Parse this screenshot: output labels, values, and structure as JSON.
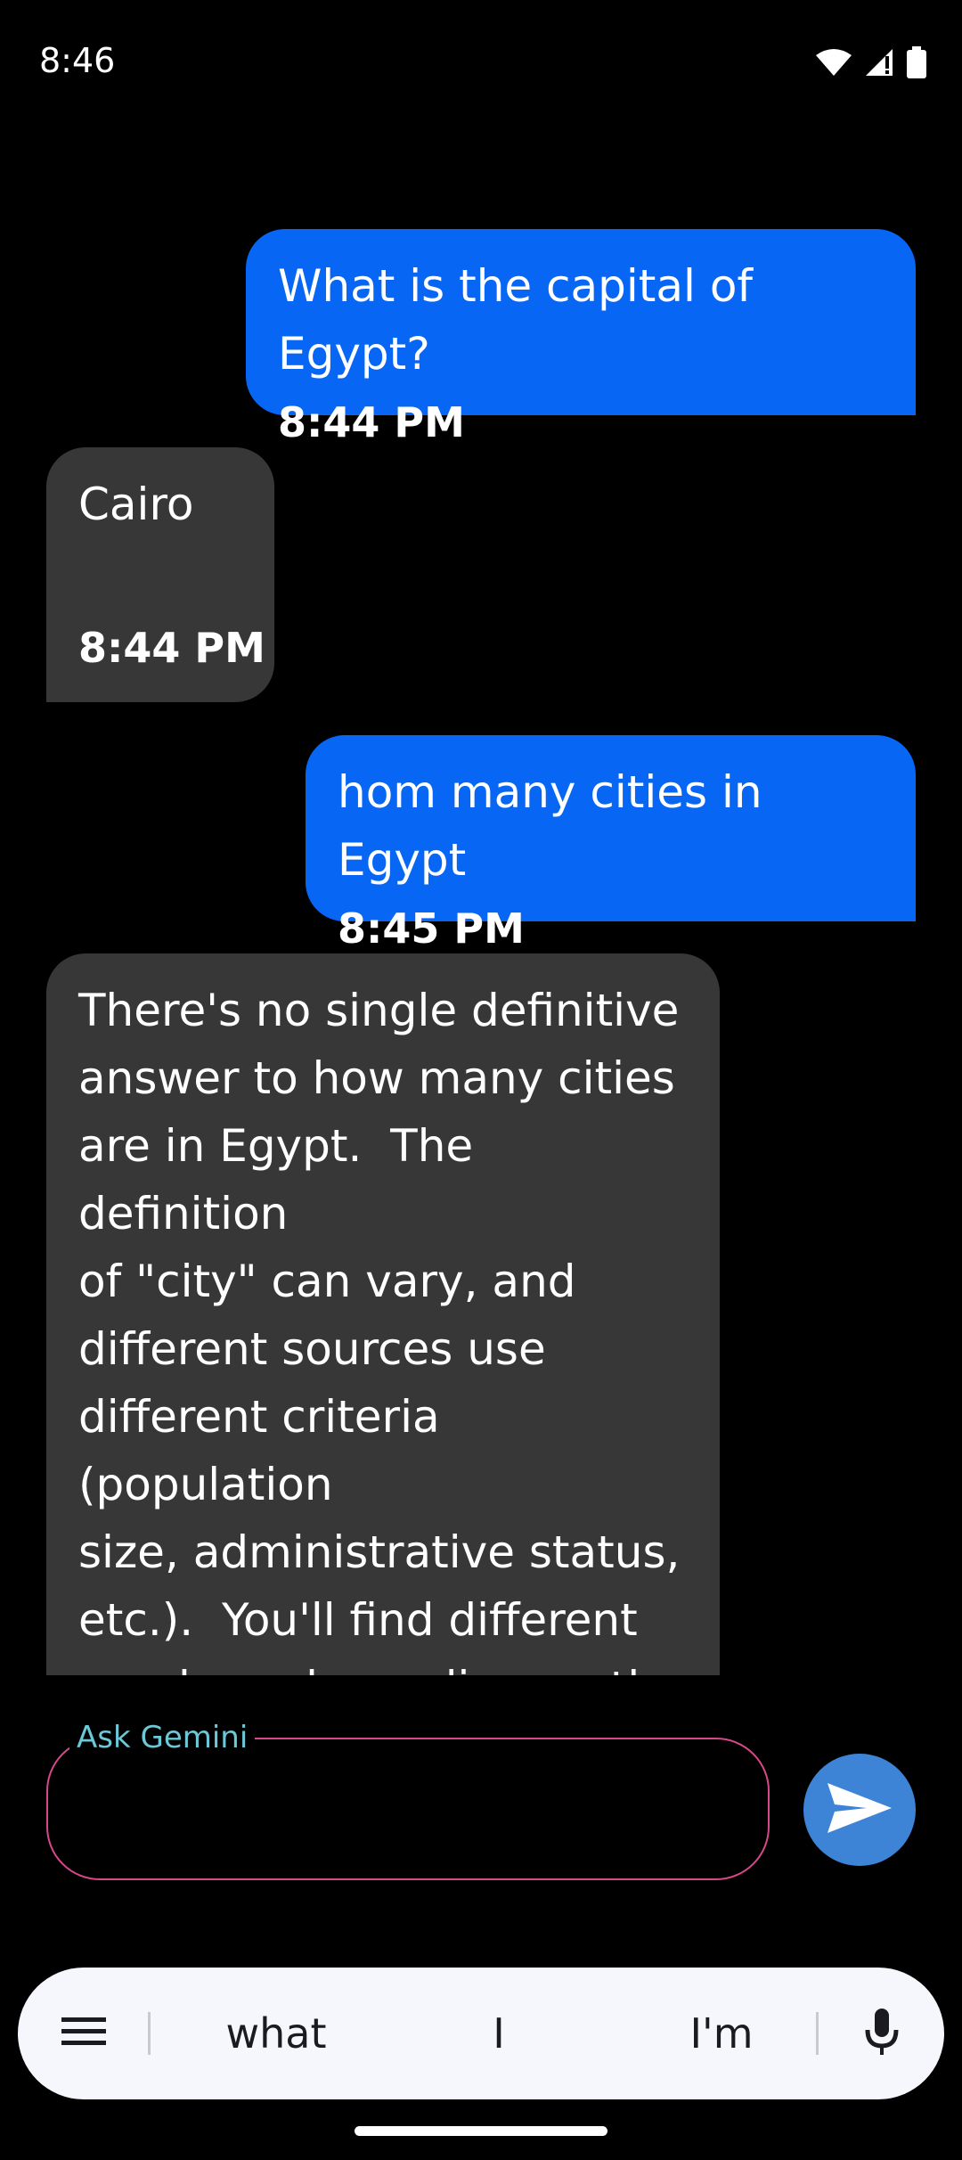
{
  "status_bar": {
    "time": "8:46",
    "icons": [
      "wifi-icon",
      "signal-icon",
      "battery-icon"
    ]
  },
  "messages": [
    {
      "role": "user",
      "text": "What is the capital of Egypt?",
      "time": "8:44 PM"
    },
    {
      "role": "bot",
      "text": "Cairo",
      "time": "8:44 PM"
    },
    {
      "role": "user",
      "text": "hom many cities in Egypt",
      "time": "8:45 PM"
    },
    {
      "role": "bot",
      "text": "There's no single definitive\nanswer to how many cities\nare in Egypt.  The definition\nof \"city\" can vary, and\ndifferent sources use\ndifferent criteria (population\nsize, administrative status,\netc.).  You'll find different\nnumbers depending on the\nsource.  Egypt has many\nlarge population centers and",
      "time": ""
    }
  ],
  "input": {
    "label": "Ask Gemini",
    "value": "",
    "placeholder": ""
  },
  "keyboard": {
    "suggestions": [
      "what",
      "I",
      "I'm"
    ]
  },
  "colors": {
    "user_bubble": "#0866f4",
    "bot_bubble": "#373737",
    "input_border": "#d6488a",
    "input_label": "#6cc8d6",
    "send_button": "#3d83d6"
  }
}
